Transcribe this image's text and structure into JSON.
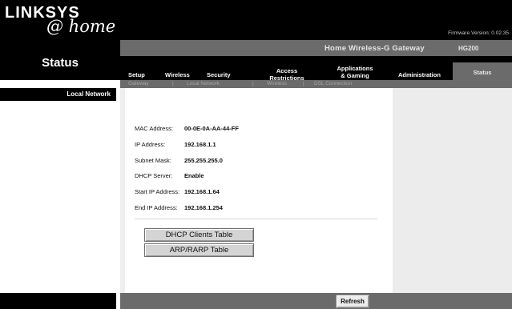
{
  "header": {
    "logo_main": "LINKSYS",
    "logo_sub": "@ home",
    "firmware_label": "Firmware Version: 0.02.35"
  },
  "product": {
    "name": "Home Wireless-G Gateway",
    "model": "HG200"
  },
  "section_title": "Status",
  "nav": {
    "setup": "Setup",
    "wireless": "Wireless",
    "security": "Security",
    "access_line1": "Access",
    "access_line2": "Restrictions",
    "apps_line1": "Applications",
    "apps_line2": "& Gaming",
    "administration": "Administration",
    "status": "Status"
  },
  "subnav": {
    "gateway": "Gateway",
    "sep1": "|",
    "local_network": "Local Network",
    "sep2": "|",
    "wireless": "Wireless",
    "sep3": "|",
    "dsl_connection": "DSL Connection"
  },
  "left": {
    "label": "Local Network"
  },
  "fields": [
    {
      "label": "MAC Address:",
      "value": "00-0E-0A-AA-44-FF"
    },
    {
      "label": "IP Address:",
      "value": "192.168.1.1"
    },
    {
      "label": "Subnet Mask:",
      "value": "255.255.255.0"
    },
    {
      "label": "DHCP Server:",
      "value": "Enable"
    },
    {
      "label": "Start IP Address:",
      "value": "192.168.1.64"
    },
    {
      "label": "End IP Address:",
      "value": "192.168.1.254"
    }
  ],
  "buttons": {
    "dhcp_clients": "DHCP Clients Table",
    "arp_rarp": "ARP/RARP Table",
    "refresh": "Refresh"
  },
  "colors": {
    "header_bg": "#000000",
    "strip_bg": "#6b6b6b",
    "panel_bg": "#ececec"
  }
}
